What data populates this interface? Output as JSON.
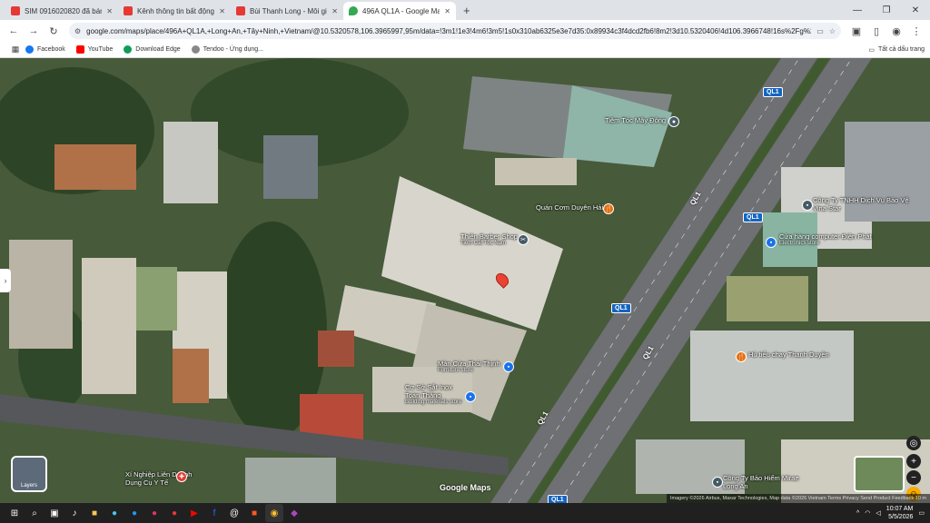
{
  "tabs": [
    {
      "title": "SIM 0916020820 đã bán - Sim",
      "color": "#e53935",
      "active": false
    },
    {
      "title": "Kênh thông tin bất động sản",
      "color": "#e53935",
      "active": false
    },
    {
      "title": "Bùi Thanh Long - Môi giới chuy",
      "color": "#e53935",
      "active": false
    },
    {
      "title": "496A QL1A - Google Maps",
      "color": "#34a853",
      "active": true
    }
  ],
  "window_controls": {
    "minimize": "—",
    "restore": "❐",
    "close": "✕"
  },
  "toolbar": {
    "url": "google.com/maps/place/496A+QL1A,+Long+An,+Tây+Ninh,+Vietnam/@10.5320578,106.3965997,95m/data=!3m1!1e3!4m6!3m5!1s0x310ab6325e3e7d35:0x89934c3f4dcd2fb6!8m2!3d10.5320406!4d106.3966748!16s%2Fg%2F11j8n13yhr?...",
    "profile_initial": "T"
  },
  "bookmarks": [
    {
      "label": "Facebook",
      "color": "#1877f2"
    },
    {
      "label": "YouTube",
      "color": "#ff0000"
    },
    {
      "label": "Download Edge",
      "color": "#0f9d58"
    },
    {
      "label": "Tendoo - Ứng dụng...",
      "color": "#888888"
    }
  ],
  "all_bookmarks": "Tất cả dấu trang",
  "map": {
    "labels": [
      {
        "text": "Tiệm Tóc Mây Đông",
        "sub": ""
      },
      {
        "text": "Quán Cơm Duyên Hải",
        "sub": ""
      },
      {
        "text": "Thiên Barber Shop",
        "sub": "Tiệm Cắt Tóc Nam"
      },
      {
        "text": "Công Ty TNHH Dịch Vụ Bảo Vệ Vina Star",
        "sub": ""
      },
      {
        "text": "Cửa hàng computer Điện Phát",
        "sub": "Electronics store"
      },
      {
        "text": "Hủ tiếu chay Thanh Duyên",
        "sub": ""
      },
      {
        "text": "Màn Cửa Thái Thịnh",
        "sub": "Furniture store"
      },
      {
        "text": "Cơ Sở Sắt Inox Toàn Thắng",
        "sub": "Building materials store"
      },
      {
        "text": "Xí Nghiệp Liên Doanh Dụng Cụ Y Tế",
        "sub": ""
      },
      {
        "text": "Công Ty Bảo Hiểm Mirae Long An",
        "sub": ""
      }
    ],
    "road_shields": [
      "QL1",
      "QL1",
      "QL1",
      "QL1"
    ],
    "road_names": [
      "QL1",
      "QL1",
      "QL1"
    ],
    "layers_label": "Layers",
    "google_maps": "Google Maps",
    "attribution": "Imagery ©2026 Airbus, Maxar Technologies, Map data ©2026   Vietnam   Terms   Privacy   Send Product Feedback   10 m"
  },
  "taskbar": {
    "time": "10:07 AM",
    "date": "5/5/2026"
  }
}
